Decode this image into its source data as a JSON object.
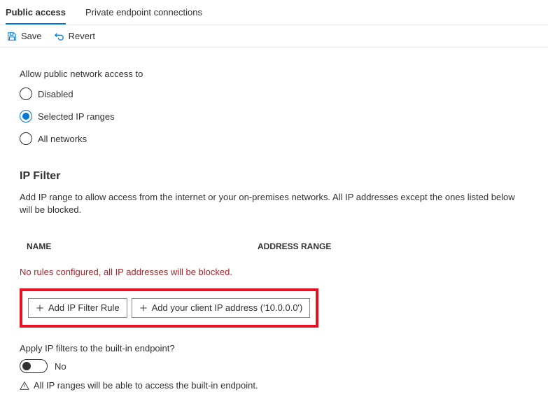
{
  "tabs": {
    "public": "Public access",
    "private": "Private endpoint connections"
  },
  "toolbar": {
    "save": "Save",
    "revert": "Revert"
  },
  "access": {
    "label": "Allow public network access to",
    "options": {
      "disabled": "Disabled",
      "selected_ip": "Selected IP ranges",
      "all": "All networks"
    }
  },
  "ipfilter": {
    "heading": "IP Filter",
    "description": "Add IP range to allow access from the internet or your on-premises networks. All IP addresses except the ones listed below will be blocked.",
    "col_name": "NAME",
    "col_range": "ADDRESS RANGE",
    "empty": "No rules configured, all IP addresses will be blocked.",
    "add_rule": "Add IP Filter Rule",
    "add_client_ip": "Add your client IP address ('10.0.0.0')"
  },
  "builtin": {
    "question": "Apply IP filters to the built-in endpoint?",
    "toggle_value": "No",
    "info": "All IP ranges will be able to access the built-in endpoint."
  }
}
